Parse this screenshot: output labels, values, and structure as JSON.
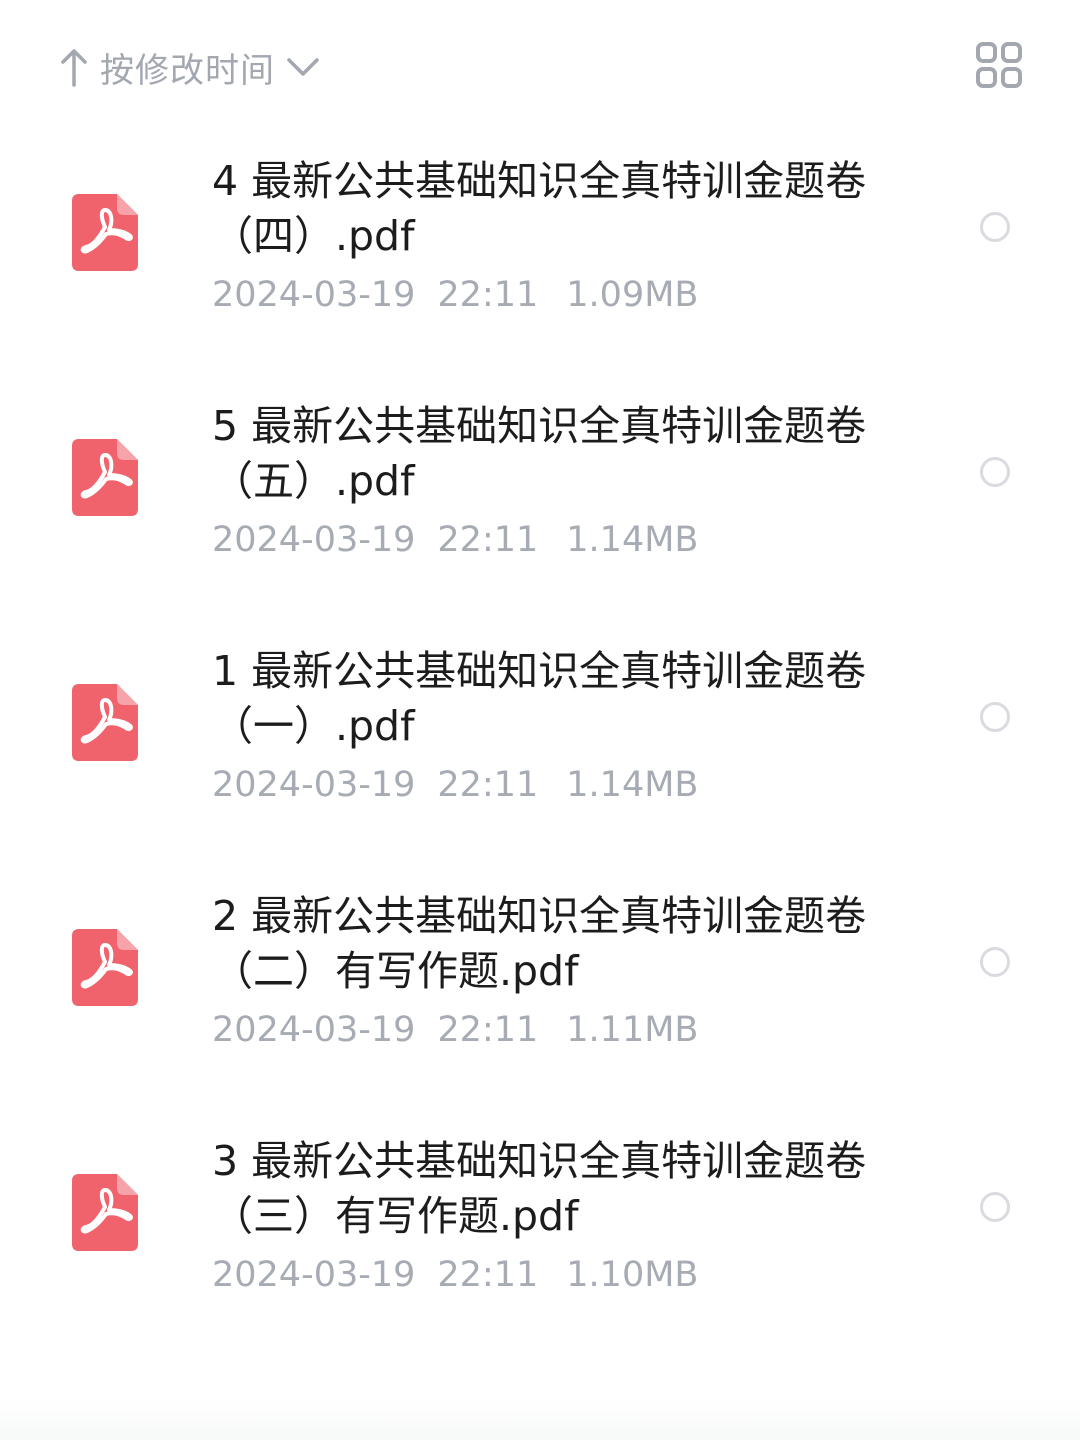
{
  "sort": {
    "label": "按修改时间",
    "direction_icon": "arrow-up-icon",
    "dropdown_icon": "chevron-down-icon"
  },
  "view_toggle": {
    "icon": "grid-view-icon"
  },
  "colors": {
    "pdf_icon": "#f0636d",
    "file_name": "#1c1c1e",
    "meta": "#a6abb4",
    "radio_border": "#d9dbe0"
  },
  "files": [
    {
      "name": "4 最新公共基础知识全真特训金题卷（四）.pdf",
      "date": "2024-03-19",
      "time": "22:11",
      "size": "1.09MB",
      "icon": "pdf-file-icon",
      "selected": false
    },
    {
      "name": "5 最新公共基础知识全真特训金题卷（五）.pdf",
      "date": "2024-03-19",
      "time": "22:11",
      "size": "1.14MB",
      "icon": "pdf-file-icon",
      "selected": false
    },
    {
      "name": "1 最新公共基础知识全真特训金题卷（一）.pdf",
      "date": "2024-03-19",
      "time": "22:11",
      "size": "1.14MB",
      "icon": "pdf-file-icon",
      "selected": false
    },
    {
      "name": "2 最新公共基础知识全真特训金题卷（二）有写作题.pdf",
      "date": "2024-03-19",
      "time": "22:11",
      "size": "1.11MB",
      "icon": "pdf-file-icon",
      "selected": false
    },
    {
      "name": "3 最新公共基础知识全真特训金题卷（三）有写作题.pdf",
      "date": "2024-03-19",
      "time": "22:11",
      "size": "1.10MB",
      "icon": "pdf-file-icon",
      "selected": false
    }
  ]
}
